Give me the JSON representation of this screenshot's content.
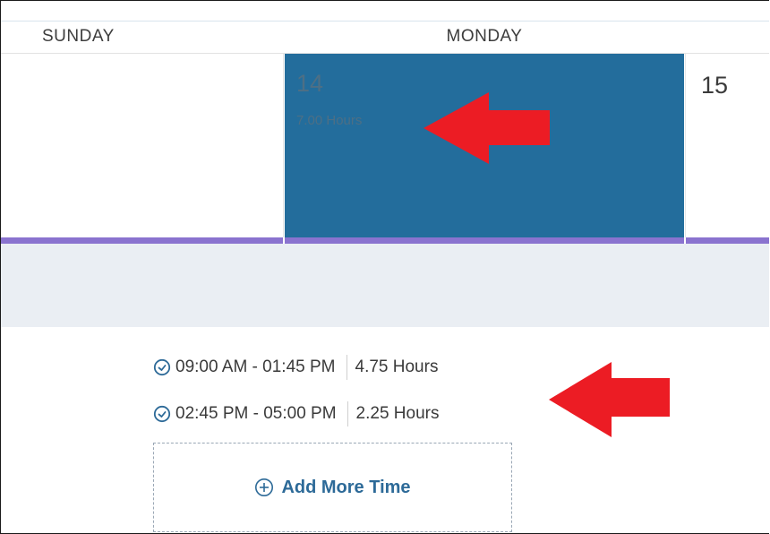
{
  "calendar": {
    "days": [
      {
        "name": "SUNDAY"
      },
      {
        "name": "MONDAY",
        "date": "14",
        "total_hours": "7.00 Hours",
        "selected": true
      },
      {
        "date": "15"
      }
    ],
    "selected_color": "#236d9c",
    "week_bar_color": "#8a73cf"
  },
  "time_entries": [
    {
      "range": "09:00 AM - 01:45 PM",
      "hours": "4.75 Hours",
      "icon": "clock-icon"
    },
    {
      "range": "02:45 PM - 05:00 PM",
      "hours": "2.25 Hours",
      "icon": "clock-icon"
    }
  ],
  "add_time": {
    "label": "Add More Time",
    "icon": "plus-circle-icon",
    "color": "#2d6a98"
  },
  "annotation": {
    "arrow_color": "#ec1c24"
  }
}
